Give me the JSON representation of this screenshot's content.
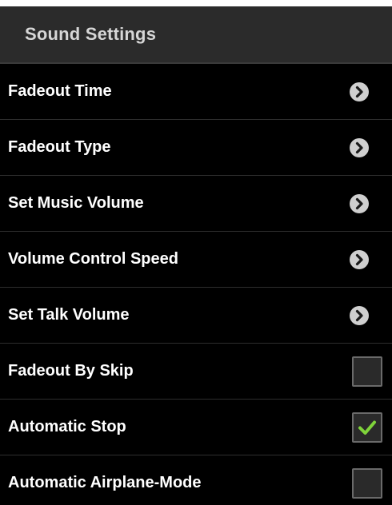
{
  "header": {
    "title": "Sound Settings"
  },
  "colors": {
    "background": "#000000",
    "header_background": "#2b2b2b",
    "check_color": "#7fd33a"
  },
  "items": [
    {
      "label": "Fadeout Time",
      "type": "navigation",
      "icon": "chevron-right-icon"
    },
    {
      "label": "Fadeout Type",
      "type": "navigation",
      "icon": "chevron-right-icon"
    },
    {
      "label": "Set Music Volume",
      "type": "navigation",
      "icon": "chevron-right-icon"
    },
    {
      "label": "Volume Control Speed",
      "type": "navigation",
      "icon": "chevron-right-icon"
    },
    {
      "label": "Set Talk Volume",
      "type": "navigation",
      "icon": "chevron-right-icon"
    },
    {
      "label": "Fadeout By Skip",
      "type": "checkbox",
      "checked": false
    },
    {
      "label": "Automatic Stop",
      "type": "checkbox",
      "checked": true
    },
    {
      "label": "Automatic Airplane-Mode",
      "type": "checkbox",
      "checked": false
    }
  ]
}
